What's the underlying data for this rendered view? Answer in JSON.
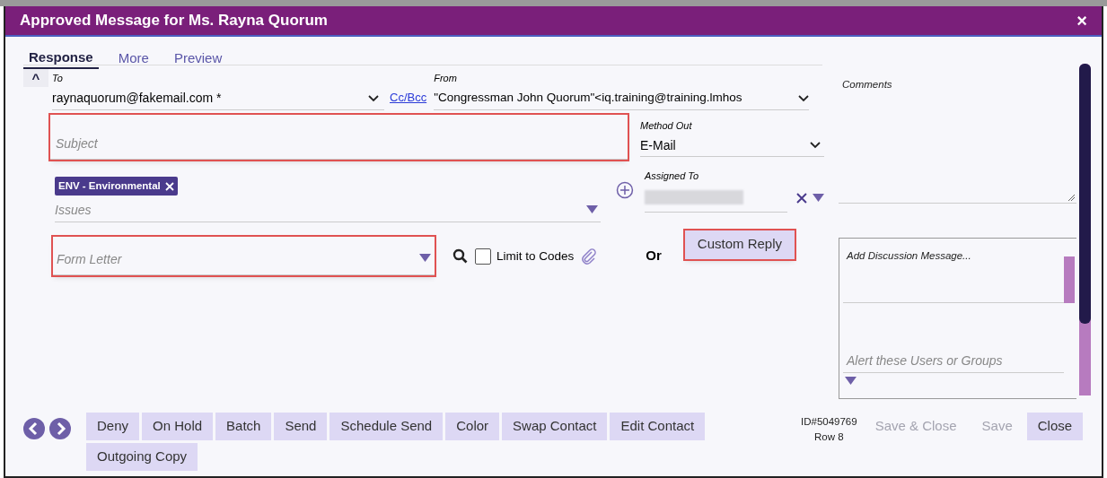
{
  "window": {
    "title": "Approved Message for Ms. Rayna Quorum",
    "close": "×"
  },
  "tabs": [
    {
      "label": "Response",
      "selected": true
    },
    {
      "label": "More",
      "selected": false
    },
    {
      "label": "Preview",
      "selected": false
    }
  ],
  "collapse": "^",
  "to": {
    "label": "To",
    "value": "raynaquorum@fakemail.com *"
  },
  "cc_bcc": "Cc/Bcc",
  "from": {
    "label": "From",
    "value": "\"Congressman John Quorum\"<iq.training@training.lmhos"
  },
  "subject": {
    "placeholder": "Subject",
    "highlighted": true
  },
  "method_out": {
    "label": "Method Out",
    "value": "E-Mail"
  },
  "issues": {
    "tags": [
      {
        "label": "ENV - Environmental"
      }
    ],
    "placeholder": "Issues"
  },
  "assigned_to": {
    "label": "Assigned To"
  },
  "form_letter": {
    "placeholder": "Form Letter",
    "highlighted": true
  },
  "limit_to_codes": {
    "label": "Limit to Codes",
    "checked": false
  },
  "or": "Or",
  "custom_reply": {
    "label": "Custom Reply",
    "highlighted": true
  },
  "comments": {
    "label": "Comments"
  },
  "discussion": {
    "placeholder": "Add Discussion Message..."
  },
  "alert": {
    "placeholder": "Alert these Users or Groups"
  },
  "actions": [
    "Deny",
    "On Hold",
    "Batch",
    "Send",
    "Schedule Send",
    "Color",
    "Swap Contact",
    "Edit Contact",
    "Outgoing Copy"
  ],
  "record": {
    "id": "ID#5049769",
    "row": "Row 8"
  },
  "footer_buttons": [
    {
      "label": "Save & Close",
      "disabled": true
    },
    {
      "label": "Save",
      "disabled": true
    },
    {
      "label": "Close",
      "disabled": false
    }
  ]
}
